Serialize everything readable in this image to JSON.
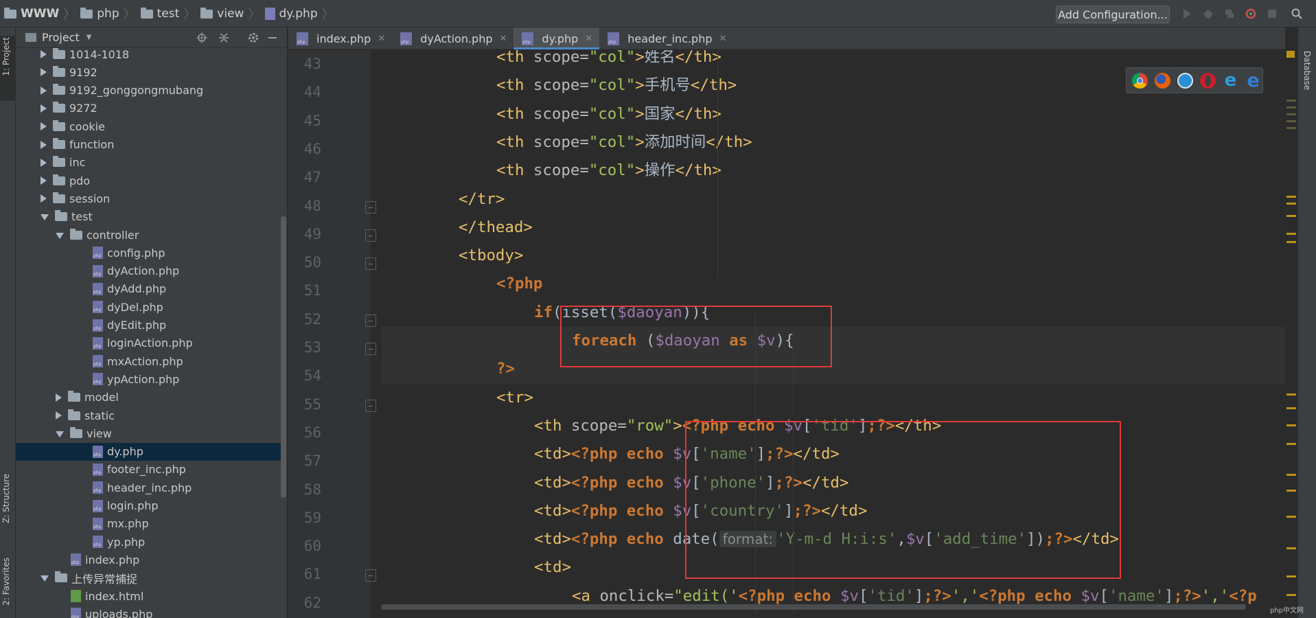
{
  "breadcrumb": {
    "items": [
      "WWW",
      "php",
      "test",
      "view",
      "dy.php"
    ]
  },
  "toolbar": {
    "add_configuration": "Add Configuration..."
  },
  "left_stripe": {
    "project": "1: Project",
    "structure": "Z: Structure",
    "favorites": "2: Favorites"
  },
  "right_stripe": {
    "database": "Database"
  },
  "project_panel": {
    "title": "Project",
    "tree": [
      {
        "label": "1014-1018",
        "type": "folder",
        "level": 1,
        "expanded": false
      },
      {
        "label": "9192",
        "type": "folder",
        "level": 1,
        "expanded": false
      },
      {
        "label": "9192_gonggongmubang",
        "type": "folder",
        "level": 1,
        "expanded": false
      },
      {
        "label": "9272",
        "type": "folder",
        "level": 1,
        "expanded": false
      },
      {
        "label": "cookie",
        "type": "folder",
        "level": 1,
        "expanded": false
      },
      {
        "label": "function",
        "type": "folder",
        "level": 1,
        "expanded": false
      },
      {
        "label": "inc",
        "type": "folder",
        "level": 1,
        "expanded": false
      },
      {
        "label": "pdo",
        "type": "folder",
        "level": 1,
        "expanded": false
      },
      {
        "label": "session",
        "type": "folder",
        "level": 1,
        "expanded": false
      },
      {
        "label": "test",
        "type": "folder",
        "level": 1,
        "expanded": true
      },
      {
        "label": "controller",
        "type": "folder",
        "level": 2,
        "expanded": true
      },
      {
        "label": "config.php",
        "type": "php",
        "level": 3
      },
      {
        "label": "dyAction.php",
        "type": "php",
        "level": 3
      },
      {
        "label": "dyAdd.php",
        "type": "php",
        "level": 3
      },
      {
        "label": "dyDel.php",
        "type": "php",
        "level": 3
      },
      {
        "label": "dyEdit.php",
        "type": "php",
        "level": 3
      },
      {
        "label": "loginAction.php",
        "type": "php",
        "level": 3
      },
      {
        "label": "mxAction.php",
        "type": "php",
        "level": 3
      },
      {
        "label": "ypAction.php",
        "type": "php",
        "level": 3
      },
      {
        "label": "model",
        "type": "folder",
        "level": 2,
        "expanded": false
      },
      {
        "label": "static",
        "type": "folder",
        "level": 2,
        "expanded": false
      },
      {
        "label": "view",
        "type": "folder",
        "level": 2,
        "expanded": true
      },
      {
        "label": "dy.php",
        "type": "php",
        "level": 3,
        "selected": true
      },
      {
        "label": "footer_inc.php",
        "type": "php",
        "level": 3
      },
      {
        "label": "header_inc.php",
        "type": "php",
        "level": 3
      },
      {
        "label": "login.php",
        "type": "php",
        "level": 3
      },
      {
        "label": "mx.php",
        "type": "php",
        "level": 3
      },
      {
        "label": "yp.php",
        "type": "php",
        "level": 3
      },
      {
        "label": "index.php",
        "type": "php",
        "level": 2
      },
      {
        "label": "上传异常捕捉",
        "type": "folder",
        "level": 1,
        "expanded": true
      },
      {
        "label": "index.html",
        "type": "html",
        "level": 2
      },
      {
        "label": "uploads.php",
        "type": "php",
        "level": 2
      }
    ]
  },
  "tabs": [
    {
      "label": "index.php",
      "active": false
    },
    {
      "label": "dyAction.php",
      "active": false
    },
    {
      "label": "dy.php",
      "active": true
    },
    {
      "label": "header_inc.php",
      "active": false
    }
  ],
  "editor": {
    "lines": [
      {
        "n": "43",
        "tokens": [
          [
            "t-tag",
            "<th "
          ],
          [
            "t-attr",
            "scope="
          ],
          [
            "t-str",
            "\"col\""
          ],
          [
            "t-tag",
            ">"
          ],
          [
            "t-plain",
            "姓名"
          ],
          [
            "t-tag",
            "</th>"
          ]
        ]
      },
      {
        "n": "44",
        "tokens": [
          [
            "t-tag",
            "<th "
          ],
          [
            "t-attr",
            "scope="
          ],
          [
            "t-str",
            "\"col\""
          ],
          [
            "t-tag",
            ">"
          ],
          [
            "t-plain",
            "手机号"
          ],
          [
            "t-tag",
            "</th>"
          ]
        ]
      },
      {
        "n": "45",
        "tokens": [
          [
            "t-tag",
            "<th "
          ],
          [
            "t-attr",
            "scope="
          ],
          [
            "t-str",
            "\"col\""
          ],
          [
            "t-tag",
            ">"
          ],
          [
            "t-plain",
            "国家"
          ],
          [
            "t-tag",
            "</th>"
          ]
        ]
      },
      {
        "n": "46",
        "tokens": [
          [
            "t-tag",
            "<th "
          ],
          [
            "t-attr",
            "scope="
          ],
          [
            "t-str",
            "\"col\""
          ],
          [
            "t-tag",
            ">"
          ],
          [
            "t-plain",
            "添加时间"
          ],
          [
            "t-tag",
            "</th>"
          ]
        ]
      },
      {
        "n": "47",
        "tokens": [
          [
            "t-tag",
            "<th "
          ],
          [
            "t-attr",
            "scope="
          ],
          [
            "t-str",
            "\"col\""
          ],
          [
            "t-tag",
            ">"
          ],
          [
            "t-plain",
            "操作"
          ],
          [
            "t-tag",
            "</th>"
          ]
        ]
      },
      {
        "n": "48",
        "tokens": [
          [
            "t-tag",
            "</tr>"
          ]
        ]
      },
      {
        "n": "49",
        "tokens": [
          [
            "t-tag",
            "</thead>"
          ]
        ]
      },
      {
        "n": "50",
        "tokens": [
          [
            "t-tag",
            "<tbody>"
          ]
        ]
      },
      {
        "n": "51",
        "tokens": [
          [
            "t-php",
            "<?php"
          ]
        ]
      },
      {
        "n": "52",
        "tokens": [
          [
            "t-kw",
            "if"
          ],
          [
            "t-plain",
            "("
          ],
          [
            "t-fn",
            "isset"
          ],
          [
            "t-plain",
            "("
          ],
          [
            "t-var",
            "$daoyan"
          ],
          [
            "t-plain",
            "))"
          ],
          [
            "t-plain",
            "{"
          ]
        ]
      },
      {
        "n": "53",
        "tokens": [
          [
            "t-kw",
            "foreach"
          ],
          [
            "t-plain",
            " ("
          ],
          [
            "t-var",
            "$daoyan"
          ],
          [
            "t-kw",
            " as "
          ],
          [
            "t-var",
            "$v"
          ],
          [
            "t-plain",
            ")"
          ],
          [
            "t-plain",
            "{"
          ]
        ]
      },
      {
        "n": "54",
        "tokens": [
          [
            "t-php",
            "?>"
          ]
        ]
      },
      {
        "n": "55",
        "tokens": [
          [
            "t-tag",
            "<tr>"
          ]
        ]
      },
      {
        "n": "56",
        "tokens": [
          [
            "t-tag",
            "<th "
          ],
          [
            "t-attr",
            "scope="
          ],
          [
            "t-str",
            "\"row\""
          ],
          [
            "t-tag",
            ">"
          ],
          [
            "t-php",
            "<?php echo "
          ],
          [
            "t-var",
            "$v"
          ],
          [
            "t-plain",
            "["
          ],
          [
            "t-key",
            "'tid'"
          ],
          [
            "t-plain",
            "]"
          ],
          [
            "t-php",
            ";?>"
          ],
          [
            "t-tag",
            "</th>"
          ]
        ]
      },
      {
        "n": "57",
        "tokens": [
          [
            "t-tag",
            "<td>"
          ],
          [
            "t-php",
            "<?php echo "
          ],
          [
            "t-var",
            "$v"
          ],
          [
            "t-plain",
            "["
          ],
          [
            "t-key",
            "'name'"
          ],
          [
            "t-plain",
            "]"
          ],
          [
            "t-php",
            ";?>"
          ],
          [
            "t-tag",
            "</td>"
          ]
        ]
      },
      {
        "n": "58",
        "tokens": [
          [
            "t-tag",
            "<td>"
          ],
          [
            "t-php",
            "<?php echo "
          ],
          [
            "t-var",
            "$v"
          ],
          [
            "t-plain",
            "["
          ],
          [
            "t-key",
            "'phone'"
          ],
          [
            "t-plain",
            "]"
          ],
          [
            "t-php",
            ";?>"
          ],
          [
            "t-tag",
            "</td>"
          ]
        ]
      },
      {
        "n": "59",
        "tokens": [
          [
            "t-tag",
            "<td>"
          ],
          [
            "t-php",
            "<?php echo "
          ],
          [
            "t-var",
            "$v"
          ],
          [
            "t-plain",
            "["
          ],
          [
            "t-key",
            "'country'"
          ],
          [
            "t-plain",
            "]"
          ],
          [
            "t-php",
            ";?>"
          ],
          [
            "t-tag",
            "</td>"
          ]
        ]
      },
      {
        "n": "60",
        "tokens": [
          [
            "t-tag",
            "<td>"
          ],
          [
            "t-php",
            "<?php echo "
          ],
          [
            "t-fn",
            "date("
          ],
          [
            "hint",
            "format:"
          ],
          [
            "t-key",
            "'Y-m-d H:i:s'"
          ],
          [
            "t-plain",
            ","
          ],
          [
            "t-var",
            "$v"
          ],
          [
            "t-plain",
            "["
          ],
          [
            "t-key",
            "'add_time'"
          ],
          [
            "t-plain",
            "])"
          ],
          [
            "t-php",
            ";?>"
          ],
          [
            "t-tag",
            "</td>"
          ]
        ]
      },
      {
        "n": "61",
        "tokens": [
          [
            "t-tag",
            "<td>"
          ]
        ]
      },
      {
        "n": "62",
        "tokens": [
          [
            "t-tag",
            "<a "
          ],
          [
            "t-attr",
            "onclick="
          ],
          [
            "t-str",
            "\"edit('"
          ],
          [
            "t-php",
            "<?php echo "
          ],
          [
            "t-var",
            "$v"
          ],
          [
            "t-plain",
            "["
          ],
          [
            "t-key",
            "'tid'"
          ],
          [
            "t-plain",
            "]"
          ],
          [
            "t-php",
            ";?>"
          ],
          [
            "t-str",
            "','"
          ],
          [
            "t-php",
            "<?php echo "
          ],
          [
            "t-var",
            "$v"
          ],
          [
            "t-plain",
            "["
          ],
          [
            "t-key",
            "'name'"
          ],
          [
            "t-plain",
            "]"
          ],
          [
            "t-php",
            ";?>"
          ],
          [
            "t-str",
            "','"
          ],
          [
            "t-php",
            "<?p"
          ]
        ]
      }
    ]
  },
  "browser_icons": [
    "chrome-icon",
    "firefox-icon",
    "safari-icon",
    "opera-icon",
    "ie-icon",
    "edge-icon"
  ],
  "watermark": "php中文网"
}
